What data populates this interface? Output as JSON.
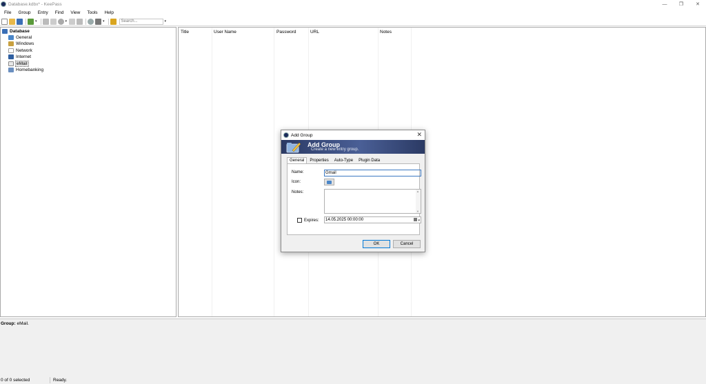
{
  "window": {
    "title": "Database.kdbx* - KeePass",
    "controls": [
      "—",
      "❐",
      "✕"
    ]
  },
  "menu": [
    "File",
    "Group",
    "Entry",
    "Find",
    "View",
    "Tools",
    "Help"
  ],
  "toolbar": {
    "search_placeholder": "Search...",
    "icons": [
      "new-db-icon",
      "open-db-icon",
      "save-icon",
      "add-entry-icon",
      "copy-user-icon",
      "copy-password-icon",
      "open-url-icon",
      "copy-icon",
      "lock-icon",
      "find-icon",
      "key-icon",
      "workspace-lock-icon"
    ]
  },
  "tree": {
    "root": "Database",
    "groups": [
      {
        "label": "General",
        "icon": "folder-icon"
      },
      {
        "label": "Windows",
        "icon": "windows-icon"
      },
      {
        "label": "Network",
        "icon": "network-icon"
      },
      {
        "label": "Internet",
        "icon": "internet-icon"
      },
      {
        "label": "eMail",
        "icon": "email-icon",
        "selected": true
      },
      {
        "label": "Homebanking",
        "icon": "homebanking-icon"
      }
    ]
  },
  "list": {
    "columns": [
      "Title",
      "User Name",
      "Password",
      "URL",
      "Notes"
    ]
  },
  "info": {
    "group_label": "Group:",
    "group_value": "eMail."
  },
  "status": {
    "selection": "0 of 0 selected",
    "state": "Ready."
  },
  "dialog": {
    "title": "Add Group",
    "banner_title": "Add Group",
    "banner_subtitle": "Create a new entry group.",
    "tabs": [
      "General",
      "Properties",
      "Auto-Type",
      "Plugin Data"
    ],
    "active_tab": "General",
    "fields": {
      "name_label": "Name:",
      "name_value": "Gmail",
      "icon_label": "Icon:",
      "notes_label": "Notes:",
      "notes_value": "",
      "expires_label": "Expires:",
      "expires_checked": false,
      "expires_value": "14.05.2025 00:00:00"
    },
    "buttons": {
      "ok": "OK",
      "cancel": "Cancel"
    }
  },
  "colors": {
    "banner": "#2b3a64",
    "focus": "#3b78c2",
    "panel_bg": "#f0f0f0"
  }
}
